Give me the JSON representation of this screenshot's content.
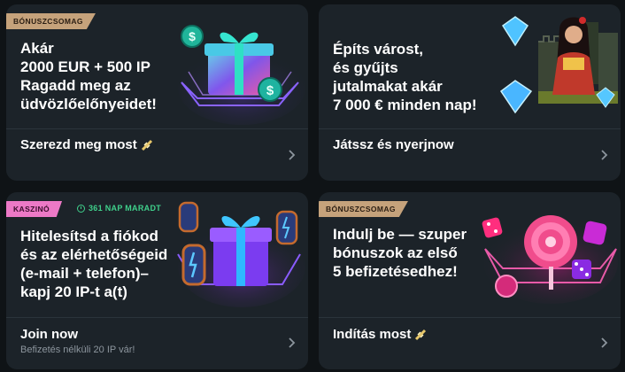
{
  "cards": [
    {
      "badge": "BÓNUSZCSOMAG",
      "title": "Akár\n2000 EUR + 500 IP\nRagadd meg az\nüdvözlőelőnyeidet!",
      "cta": "Szerezd meg most",
      "art": "gift-box-with-coins"
    },
    {
      "title": "Építs várost,\nés gyűjts\njutalmakat akár\n7 000 € minden nap!",
      "cta": "Játssz és nyerjnow",
      "art": "diamonds-and-queen"
    },
    {
      "badge": "KASZINÓ",
      "days_left": "361 NAP MARADT",
      "title": "Hitelesítsd a fiókod\nés az elérhetőségeid\n(e-mail + telefon)–\nkapj 20 IP-t a(t)",
      "cta": "Join now",
      "subtext": "Befizetés nélküli 20 IP vár!",
      "art": "purple-gift-with-lanterns"
    },
    {
      "badge": "BÓNUSZCSOMAG",
      "title": "Indulj be — szuper\nbónuszok az első\n5 befizetésedhez!",
      "cta": "Indítás most",
      "art": "lollipop-and-dice"
    }
  ],
  "colors": {
    "background": "#0f1316",
    "card": "#1c2329",
    "badge_tan": "#c5a27b",
    "badge_pink": "#ec79c6",
    "days_green": "#3fd08b"
  }
}
